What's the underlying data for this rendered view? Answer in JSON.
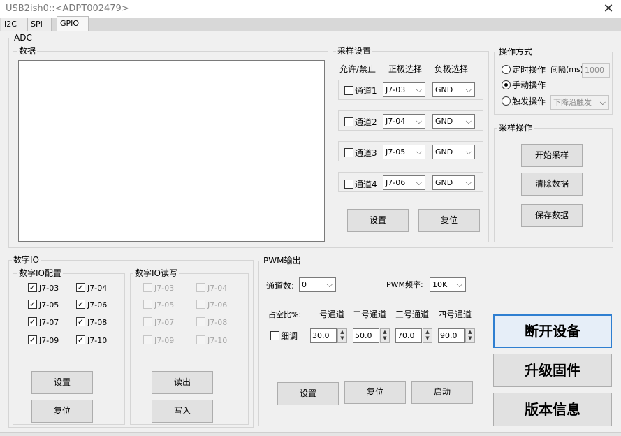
{
  "window": {
    "title": "USB2ish0::<ADPT002479>",
    "close": "✕"
  },
  "tabs": [
    "I2C",
    "SPI",
    "GPIO"
  ],
  "adc": {
    "group": "ADC",
    "data_label": "数据",
    "sampling": {
      "label": "采样设置",
      "col_enable": "允许/禁止",
      "col_pos": "正极选择",
      "col_neg": "负极选择",
      "channels": [
        {
          "name": "通道1",
          "pos": "J7-03",
          "neg": "GND"
        },
        {
          "name": "通道2",
          "pos": "J7-04",
          "neg": "GND"
        },
        {
          "name": "通道3",
          "pos": "J7-05",
          "neg": "GND"
        },
        {
          "name": "通道4",
          "pos": "J7-06",
          "neg": "GND"
        }
      ],
      "set_btn": "设置",
      "reset_btn": "复位"
    },
    "op_mode": {
      "label": "操作方式",
      "timed": "定时操作",
      "interval_label": "间隔(ms)",
      "interval_value": "1000",
      "manual": "手动操作",
      "trigger": "触发操作",
      "trigger_value": "下降沿触发"
    },
    "sample_ops": {
      "label": "采样操作",
      "start": "开始采样",
      "clear": "清除数据",
      "save": "保存数据"
    }
  },
  "digital_io": {
    "group": "数字IO",
    "config": {
      "label": "数字IO配置",
      "pins": [
        "J7-03",
        "J7-04",
        "J7-05",
        "J7-06",
        "J7-07",
        "J7-08",
        "J7-09",
        "J7-10"
      ],
      "set_btn": "设置",
      "reset_btn": "复位"
    },
    "rw": {
      "label": "数字IO读写",
      "pins": [
        "J7-03",
        "J7-04",
        "J7-05",
        "J7-06",
        "J7-07",
        "J7-08",
        "J7-09",
        "J7-10"
      ],
      "read_btn": "读出",
      "write_btn": "写入"
    }
  },
  "pwm": {
    "group": "PWM输出",
    "channels_label": "通道数:",
    "channels_value": "0",
    "freq_label": "PWM频率:",
    "freq_value": "10K",
    "duty_label": "占空比%:",
    "ch_labels": [
      "一号通道",
      "二号通道",
      "三号通道",
      "四号通道"
    ],
    "fine": "细调",
    "duty_values": [
      "30.0",
      "50.0",
      "70.0",
      "90.0"
    ],
    "set_btn": "设置",
    "reset_btn": "复位",
    "start_btn": "启动"
  },
  "device": {
    "disconnect": "断开设备",
    "upgrade": "升级固件",
    "version": "版本信息"
  }
}
